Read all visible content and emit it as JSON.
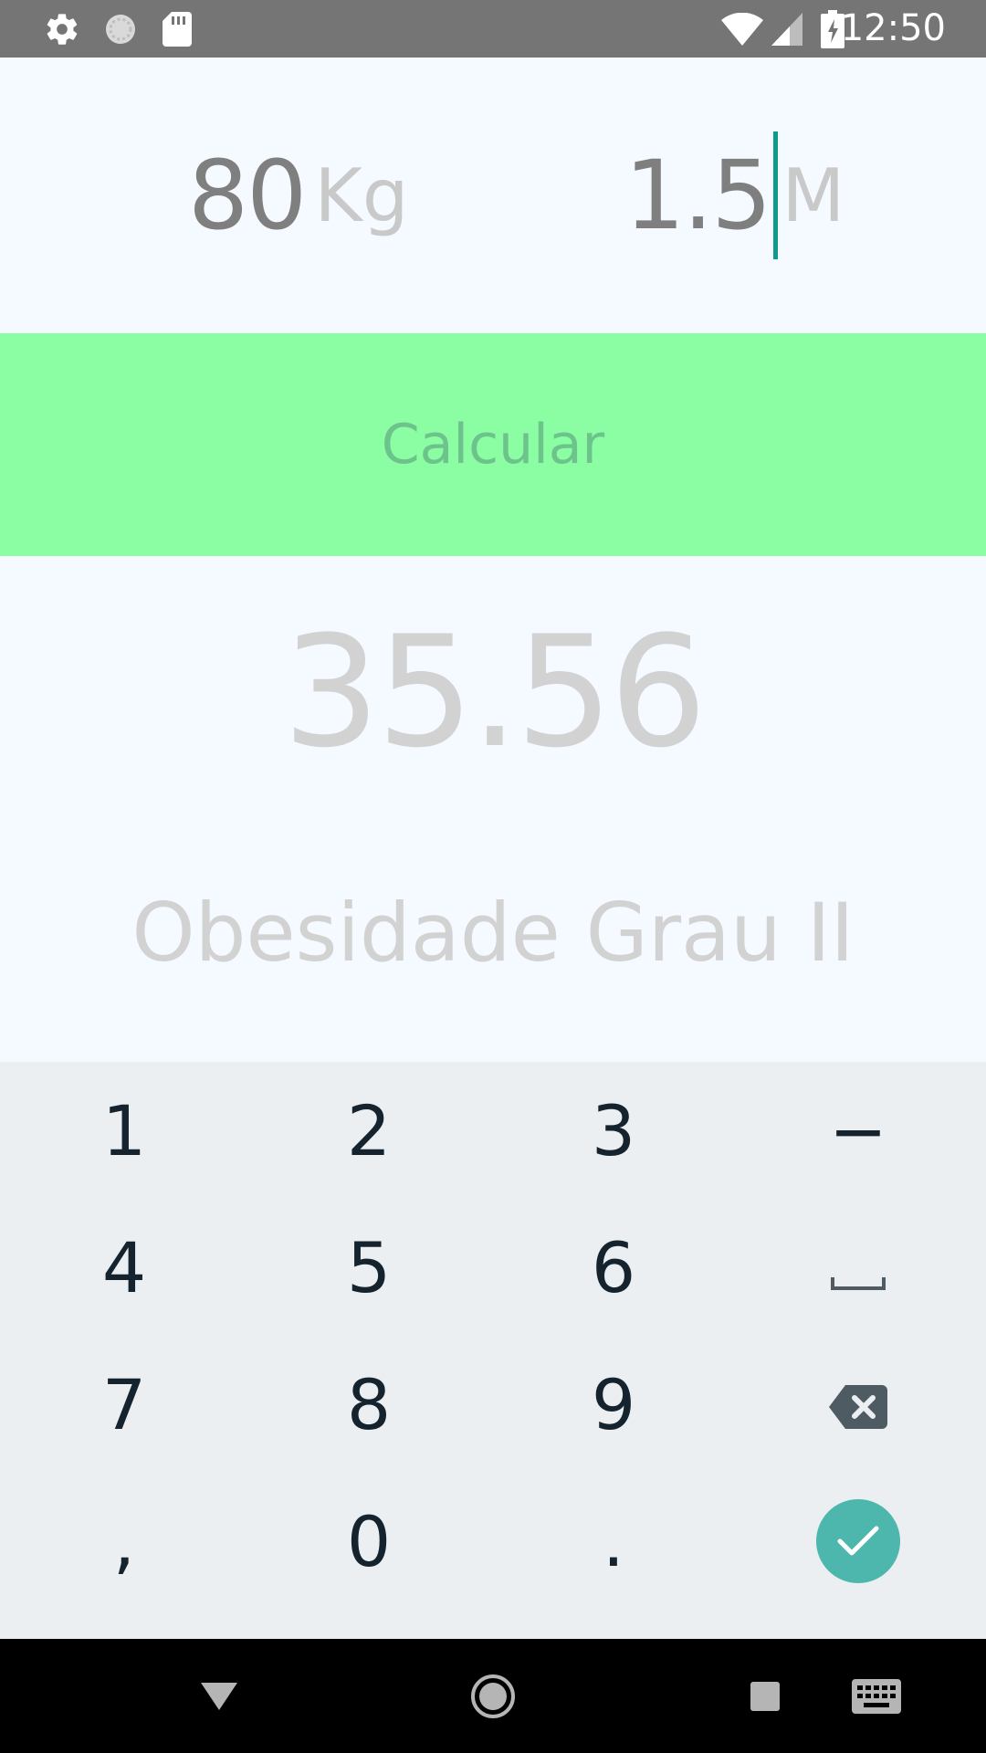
{
  "status_bar": {
    "time": "12:50",
    "left_icons": [
      "gear-icon",
      "sync-icon",
      "sd-card-icon"
    ],
    "right_icons": [
      "wifi-icon",
      "signal-icon",
      "battery-charging-icon"
    ]
  },
  "inputs": {
    "weight": {
      "value": "80",
      "unit": "Kg"
    },
    "height": {
      "value": "1.5",
      "unit": "M"
    }
  },
  "calc_button": {
    "label": "Calcular",
    "bg_color": "#8bfda2"
  },
  "result": {
    "value": "35.56",
    "classification": "Obesidade Grau II"
  },
  "keyboard": {
    "rows": [
      [
        "1",
        "2",
        "3",
        "−"
      ],
      [
        "4",
        "5",
        "6",
        "space-icon"
      ],
      [
        "7",
        "8",
        "9",
        "backspace-icon"
      ],
      [
        ",",
        "0",
        ".",
        "enter-icon"
      ]
    ],
    "k1": "1",
    "k2": "2",
    "k3": "3",
    "kminus": "−",
    "k4": "4",
    "k5": "5",
    "k6": "6",
    "k7": "7",
    "k8": "8",
    "k9": "9",
    "kcomma": ",",
    "k0": "0",
    "kdot": ".",
    "enter_color": "#4db7ae"
  },
  "nav_bar": {
    "buttons": [
      "back-icon",
      "home-icon",
      "recents-icon",
      "keyboard-icon"
    ]
  }
}
